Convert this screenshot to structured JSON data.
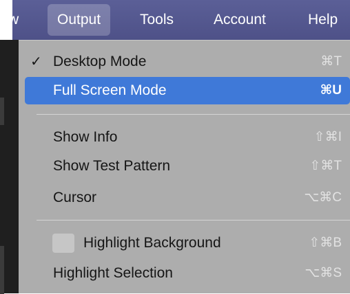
{
  "menubar": {
    "items": [
      {
        "label": "w"
      },
      {
        "label": "Output"
      },
      {
        "label": "Tools"
      },
      {
        "label": "Account"
      },
      {
        "label": "Help"
      }
    ]
  },
  "menu": {
    "items": [
      {
        "label": "Desktop Mode",
        "shortcut": "⌘T",
        "checked": true,
        "checkmark": "✓"
      },
      {
        "label": "Full Screen Mode",
        "shortcut": "⌘U",
        "selected": true
      },
      {
        "label": "Show Info",
        "shortcut": "⇧⌘I"
      },
      {
        "label": "Show Test Pattern",
        "shortcut": "⇧⌘T"
      },
      {
        "label": "Cursor",
        "shortcut": "⌥⌘C"
      },
      {
        "label": "Highlight Background",
        "shortcut": "⇧⌘B"
      },
      {
        "label": "Highlight Selection",
        "shortcut": "⌥⌘S"
      }
    ]
  }
}
